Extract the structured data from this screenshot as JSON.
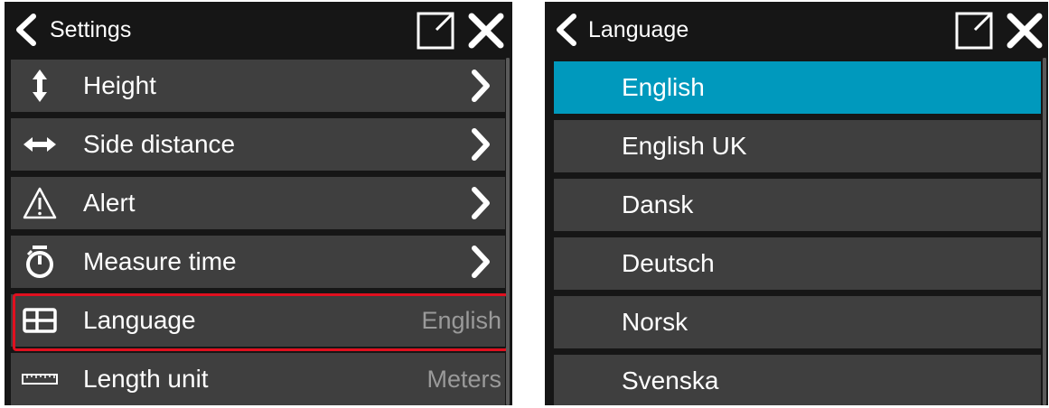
{
  "settings_panel": {
    "title": "Settings",
    "items": [
      {
        "label": "Height",
        "icon": "vertical-arrows-icon",
        "action": "chevron"
      },
      {
        "label": "Side distance",
        "icon": "horizontal-arrows-icon",
        "action": "chevron"
      },
      {
        "label": "Alert",
        "icon": "warning-triangle-icon",
        "action": "chevron"
      },
      {
        "label": "Measure time",
        "icon": "stopwatch-icon",
        "action": "chevron"
      },
      {
        "label": "Language",
        "icon": "table-icon",
        "value": "English",
        "highlighted": true
      },
      {
        "label": "Length unit",
        "icon": "ruler-icon",
        "value": "Meters"
      }
    ]
  },
  "language_panel": {
    "title": "Language",
    "selected": "English",
    "options": [
      "English",
      "English UK",
      "Dansk",
      "Deutsch",
      "Norsk",
      "Svenska"
    ]
  },
  "colors": {
    "background": "#161616",
    "row": "#3f3f3f",
    "selected": "#0099bd",
    "highlight_border": "#e0101f",
    "value_text": "#9a9a9a"
  }
}
